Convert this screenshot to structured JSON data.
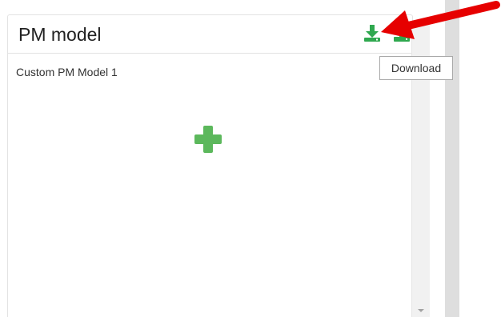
{
  "panel": {
    "title": "PM model",
    "items": [
      {
        "label": "Custom PM Model 1"
      }
    ]
  },
  "toolbar": {
    "download_icon": "download-icon",
    "upload_icon": "upload-icon",
    "add_icon": "plus-icon"
  },
  "tooltip": {
    "text": "Download"
  },
  "colors": {
    "accent_green": "#2fa84f",
    "add_green": "#5cb85c",
    "annotation_red": "#e60000"
  }
}
